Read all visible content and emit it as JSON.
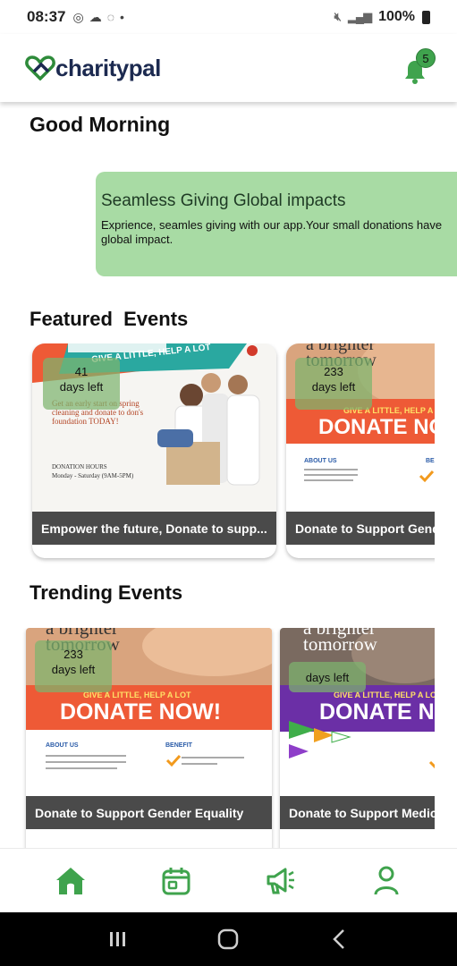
{
  "status_bar": {
    "time": "08:37",
    "battery": "100%"
  },
  "header": {
    "logo_text": "charitypal",
    "notification_count": "5"
  },
  "greeting": "Good Morning",
  "banner": {
    "title": "Seamless Giving Global impacts",
    "text": "Exprience, seamles giving with our app.Your small donations have global impact."
  },
  "featured": {
    "title": "Featured  Events",
    "cards": [
      {
        "days": "41",
        "days_label": "days left",
        "title": "Empower the future, Donate to supp..."
      },
      {
        "days": "233",
        "days_label": "days left",
        "title": "Donate to Support Gender Equality"
      }
    ]
  },
  "trending": {
    "title": "Trending Events",
    "cards": [
      {
        "days": "233",
        "days_label": "days left",
        "title": "Donate to Support Gender Equality"
      },
      {
        "days": "",
        "days_label": "days left",
        "title": "Donate to Support Medical"
      }
    ]
  },
  "poster_text": {
    "give_a_little": "GIVE A LITTLE, HELP A LOT",
    "donate_now": "DONATE NOW!",
    "brighter": "a brighter",
    "tomorrow": "tomorrow",
    "about_us": "ABOUT US",
    "benefit": "BENEFIT",
    "spring": "Get an early start on spring cleaning and donate to don's foundation TODAY!",
    "hours": "DONATION HOURS",
    "hours_value": "Monday - Saturday (9AM-5PM)"
  },
  "colors": {
    "brand_green": "#3fa34d",
    "banner_bg": "#a8dba4",
    "title_bar": "#4a4a4a",
    "poster_orange": "#ee5a36",
    "poster_purple": "#6b2fa6"
  },
  "nav": {
    "items": [
      "home-icon",
      "calendar-icon",
      "megaphone-icon",
      "profile-icon"
    ],
    "active": "home-icon"
  }
}
